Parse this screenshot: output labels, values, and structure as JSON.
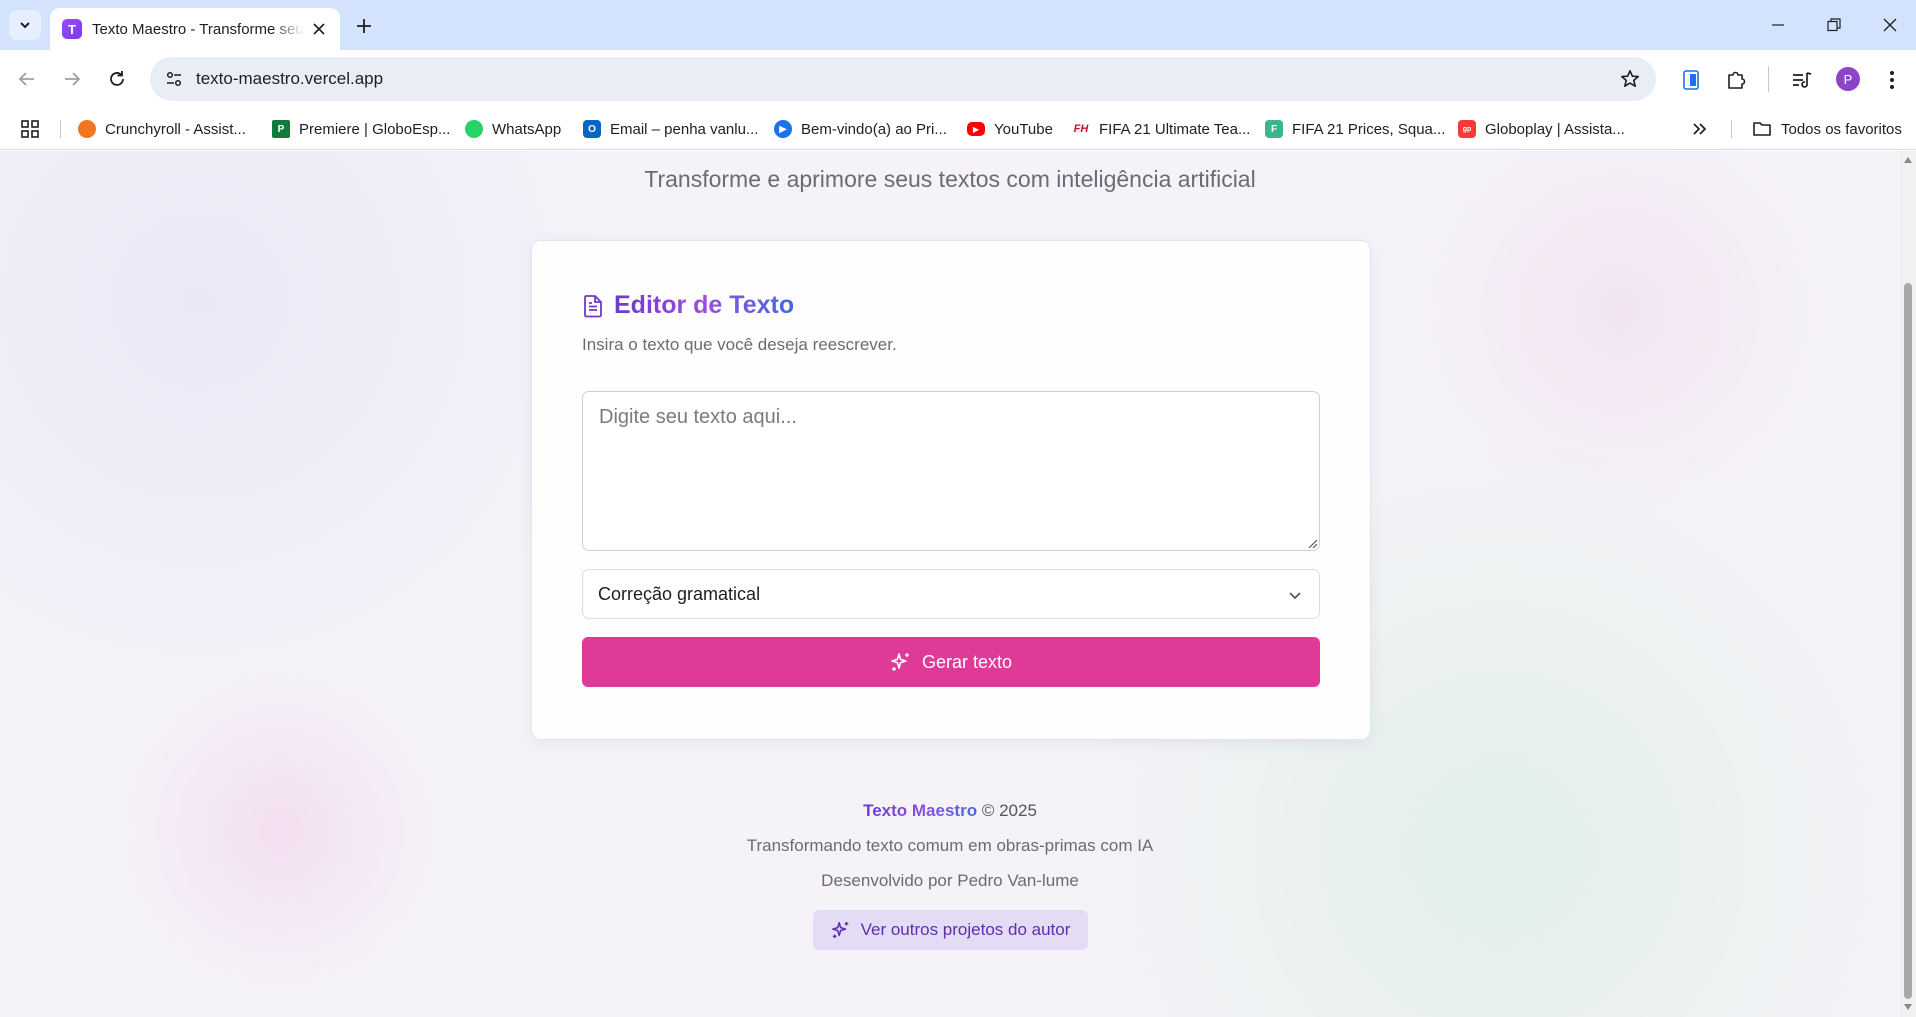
{
  "browser": {
    "tab_title": "Texto Maestro - Transforme seus textos",
    "tab_favicon_letter": "T",
    "url": "texto-maestro.vercel.app",
    "profile_initial": "P",
    "bookmarks": [
      {
        "label": "Crunchyroll - Assist...",
        "icon": "crunchyroll-icon",
        "color": "#f47521"
      },
      {
        "label": "Premiere | GloboEsp...",
        "icon": "premiere-icon",
        "color": "#0f7b3c"
      },
      {
        "label": "WhatsApp",
        "icon": "whatsapp-icon",
        "color": "#25d366"
      },
      {
        "label": "Email – penha vanlu...",
        "icon": "outlook-icon",
        "color": "#0a64c2"
      },
      {
        "label": "Bem-vindo(a) ao Pri...",
        "icon": "prime-video-icon",
        "color": "#1a73e8"
      },
      {
        "label": "YouTube",
        "icon": "youtube-icon",
        "color": "#ff0000"
      },
      {
        "label": "FIFA 21 Ultimate Tea...",
        "icon": "futhead-icon",
        "color": "#c8102e"
      },
      {
        "label": "FIFA 21 Prices, Squa...",
        "icon": "futbin-icon",
        "color": "#3cb48c"
      },
      {
        "label": "Globoplay | Assista...",
        "icon": "globoplay-icon",
        "color": "#f93a3a"
      }
    ],
    "all_bookmarks_label": "Todos os favoritos"
  },
  "page": {
    "subtitle": "Transforme e aprimore seus textos com inteligência artificial",
    "editor": {
      "title": "Editor de Texto",
      "description": "Insira o texto que você deseja reescrever.",
      "textarea_placeholder": "Digite seu texto aqui...",
      "mode_selected": "Correção gramatical",
      "generate_label": "Gerar texto"
    },
    "footer": {
      "brand": "Texto Maestro",
      "copyright": "© 2025",
      "tagline": "Transformando texto comum em obras-primas com IA",
      "author": "Desenvolvido por Pedro Van-lume",
      "projects_label": "Ver outros projetos do autor"
    }
  },
  "colors": {
    "accent_pink": "#df3a97",
    "accent_purple": "#6c3ac9",
    "projects_bg": "#e3dcf4"
  }
}
